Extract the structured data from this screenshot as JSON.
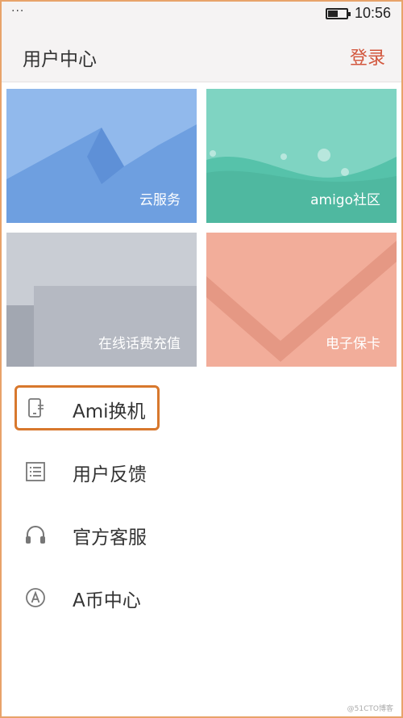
{
  "status_bar": {
    "dots": "···",
    "time": "10:56"
  },
  "header": {
    "title": "用户中心",
    "login_label": "登录"
  },
  "tiles": [
    {
      "label": "云服务"
    },
    {
      "label": "amigo社区"
    },
    {
      "label": "在线话费充值"
    },
    {
      "label": "电子保卡"
    }
  ],
  "list": [
    {
      "label": "Ami换机"
    },
    {
      "label": "用户反馈"
    },
    {
      "label": "官方客服"
    },
    {
      "label": "A币中心"
    }
  ],
  "watermark": "@51CTO博客",
  "colors": {
    "accent": "#d2563c",
    "highlight": "#d8782d"
  }
}
